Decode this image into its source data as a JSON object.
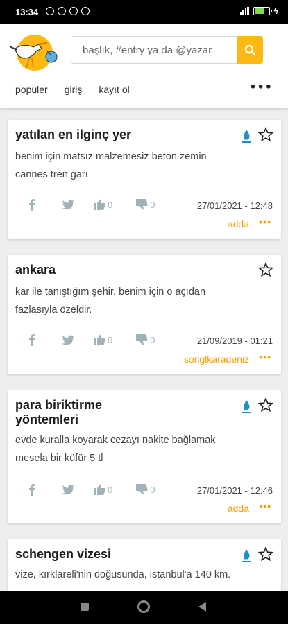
{
  "status": {
    "time": "13:34"
  },
  "header": {
    "search_placeholder": "başlık, #entry ya da @yazar",
    "nav": [
      "popüler",
      "giriş",
      "kayıt ol"
    ],
    "more": "•••"
  },
  "entries": [
    {
      "title": "yatılan en ilginç yer",
      "body_lines": [
        "benim için matsız malzemesiz beton zemin",
        "cannes tren garı"
      ],
      "upvotes": "0",
      "downvotes": "0",
      "date": "27/01/2021 - 12:48",
      "author": "adda",
      "has_drop": true
    },
    {
      "title": "ankara",
      "body_lines": [
        "kar ile tanıştığım şehir. benim için o açıdan",
        "fazlasıyla özeldir."
      ],
      "upvotes": "0",
      "downvotes": "0",
      "date": "21/09/2019 - 01:21",
      "author": "songlkaradeniz",
      "has_drop": false
    },
    {
      "title": "para biriktirme yöntemleri",
      "title_lines": [
        "para biriktirme",
        "yöntemleri"
      ],
      "body_lines": [
        "evde kuralla koyarak cezayı nakite bağlamak",
        "mesela bir küfür 5 tl"
      ],
      "upvotes": "0",
      "downvotes": "0",
      "date": "27/01/2021 - 12:46",
      "author": "adda",
      "has_drop": true
    },
    {
      "title": "schengen vizesi",
      "body_lines": [
        "vize, kırklareli'nin doğusunda, istanbul'a 140 km."
      ],
      "has_drop": true
    }
  ],
  "entry_more": "•••",
  "colors": {
    "accent": "#fdb913",
    "author": "#f0a30a",
    "drop": "#1f8fc9",
    "icon_muted": "#9fb3b8"
  }
}
